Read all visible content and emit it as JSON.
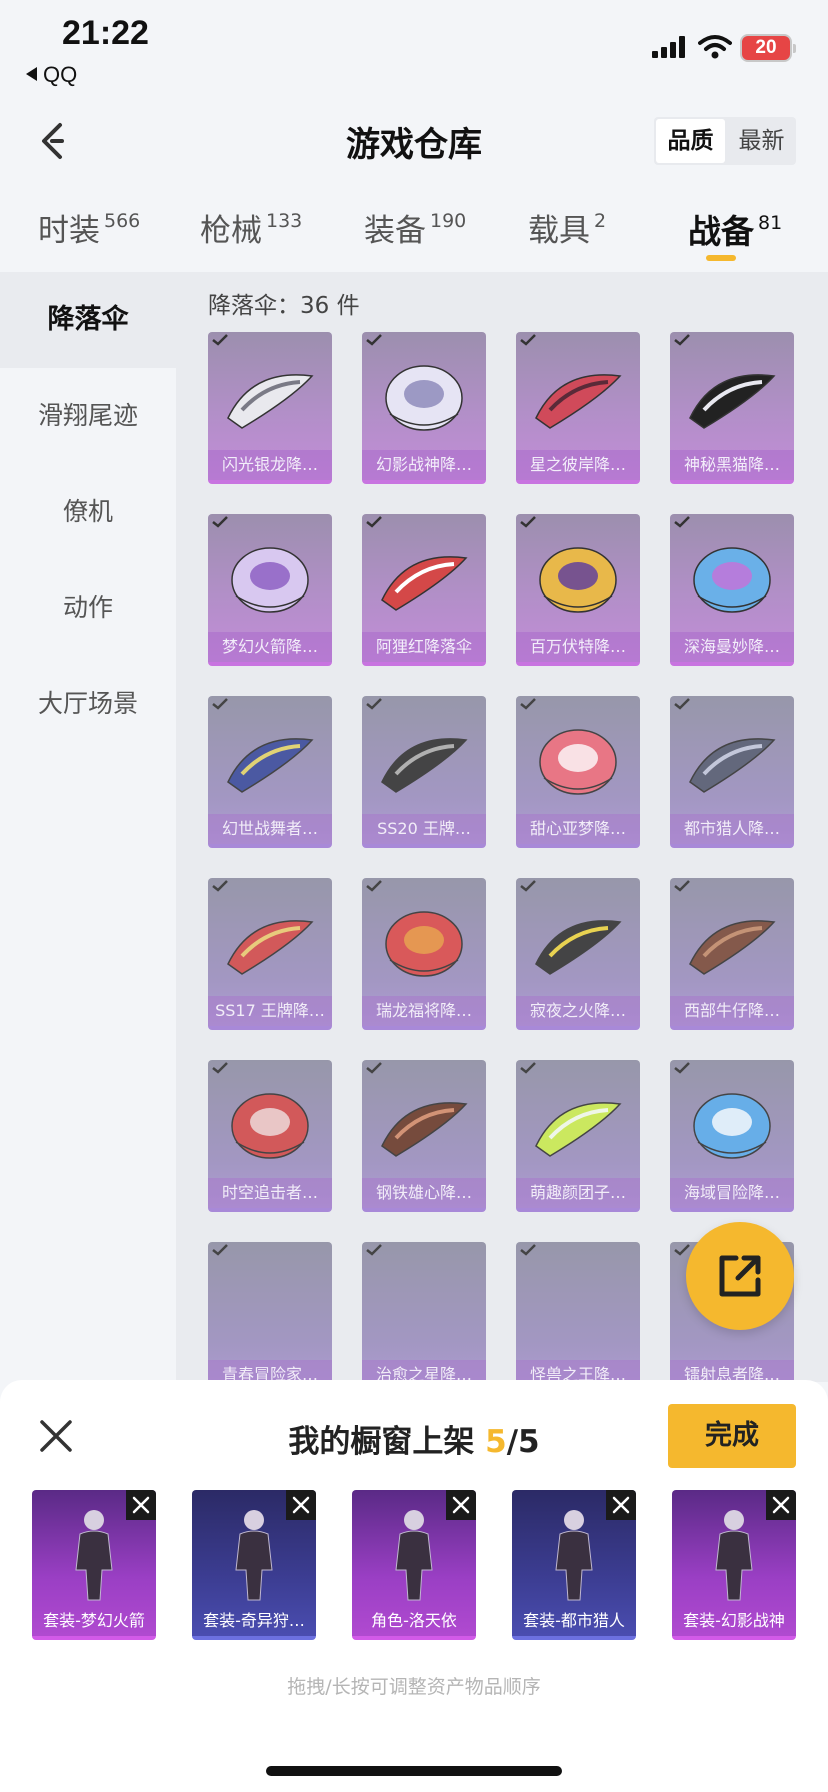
{
  "status_bar": {
    "time": "21:22",
    "back_app": "QQ",
    "battery": "20"
  },
  "header": {
    "title": "游戏仓库",
    "sort_options": [
      "品质",
      "最新"
    ],
    "sort_active": 0
  },
  "tabs": [
    {
      "label": "时装",
      "count": "566"
    },
    {
      "label": "枪械",
      "count": "133"
    },
    {
      "label": "装备",
      "count": "190"
    },
    {
      "label": "载具",
      "count": "2"
    },
    {
      "label": "战备",
      "count": "81"
    }
  ],
  "active_tab": 4,
  "sidebar": {
    "items": [
      "降落伞",
      "滑翔尾迹",
      "僚机",
      "动作",
      "大厅场景"
    ],
    "active": 0
  },
  "main": {
    "count_label": "降落伞：36 件",
    "items": [
      "闪光银龙降…",
      "幻影战神降…",
      "星之彼岸降…",
      "神秘黑猫降…",
      "梦幻火箭降…",
      "阿狸红降落伞",
      "百万伏特降…",
      "深海曼妙降…",
      "幻世战舞者…",
      "SS20 王牌…",
      "甜心亚梦降…",
      "都市猎人降…",
      "SS17 王牌降…",
      "瑞龙福将降…",
      "寂夜之火降…",
      "西部牛仔降…",
      "时空追击者…",
      "钢铁雄心降…",
      "萌趣颜团子…",
      "海域冒险降…",
      "青春冒险家…",
      "治愈之星降…",
      "怪兽之王降…",
      "镭射息者降…"
    ]
  },
  "panel": {
    "title": "我的橱窗上架",
    "count_current": "5",
    "count_total": "/5",
    "done_label": "完成",
    "items": [
      {
        "label": "套装-梦幻火箭",
        "tone": "purple"
      },
      {
        "label": "套装-奇异狩…",
        "tone": "blue"
      },
      {
        "label": "角色-洛天依",
        "tone": "purple"
      },
      {
        "label": "套装-都市猎人",
        "tone": "blue"
      },
      {
        "label": "套装-幻影战神",
        "tone": "purple"
      }
    ],
    "hint": "拖拽/长按可调整资产物品顺序"
  },
  "colors": {
    "accent": "#f5b82e",
    "card_purple": "#c38cd8",
    "background": "#f3f5f8"
  }
}
